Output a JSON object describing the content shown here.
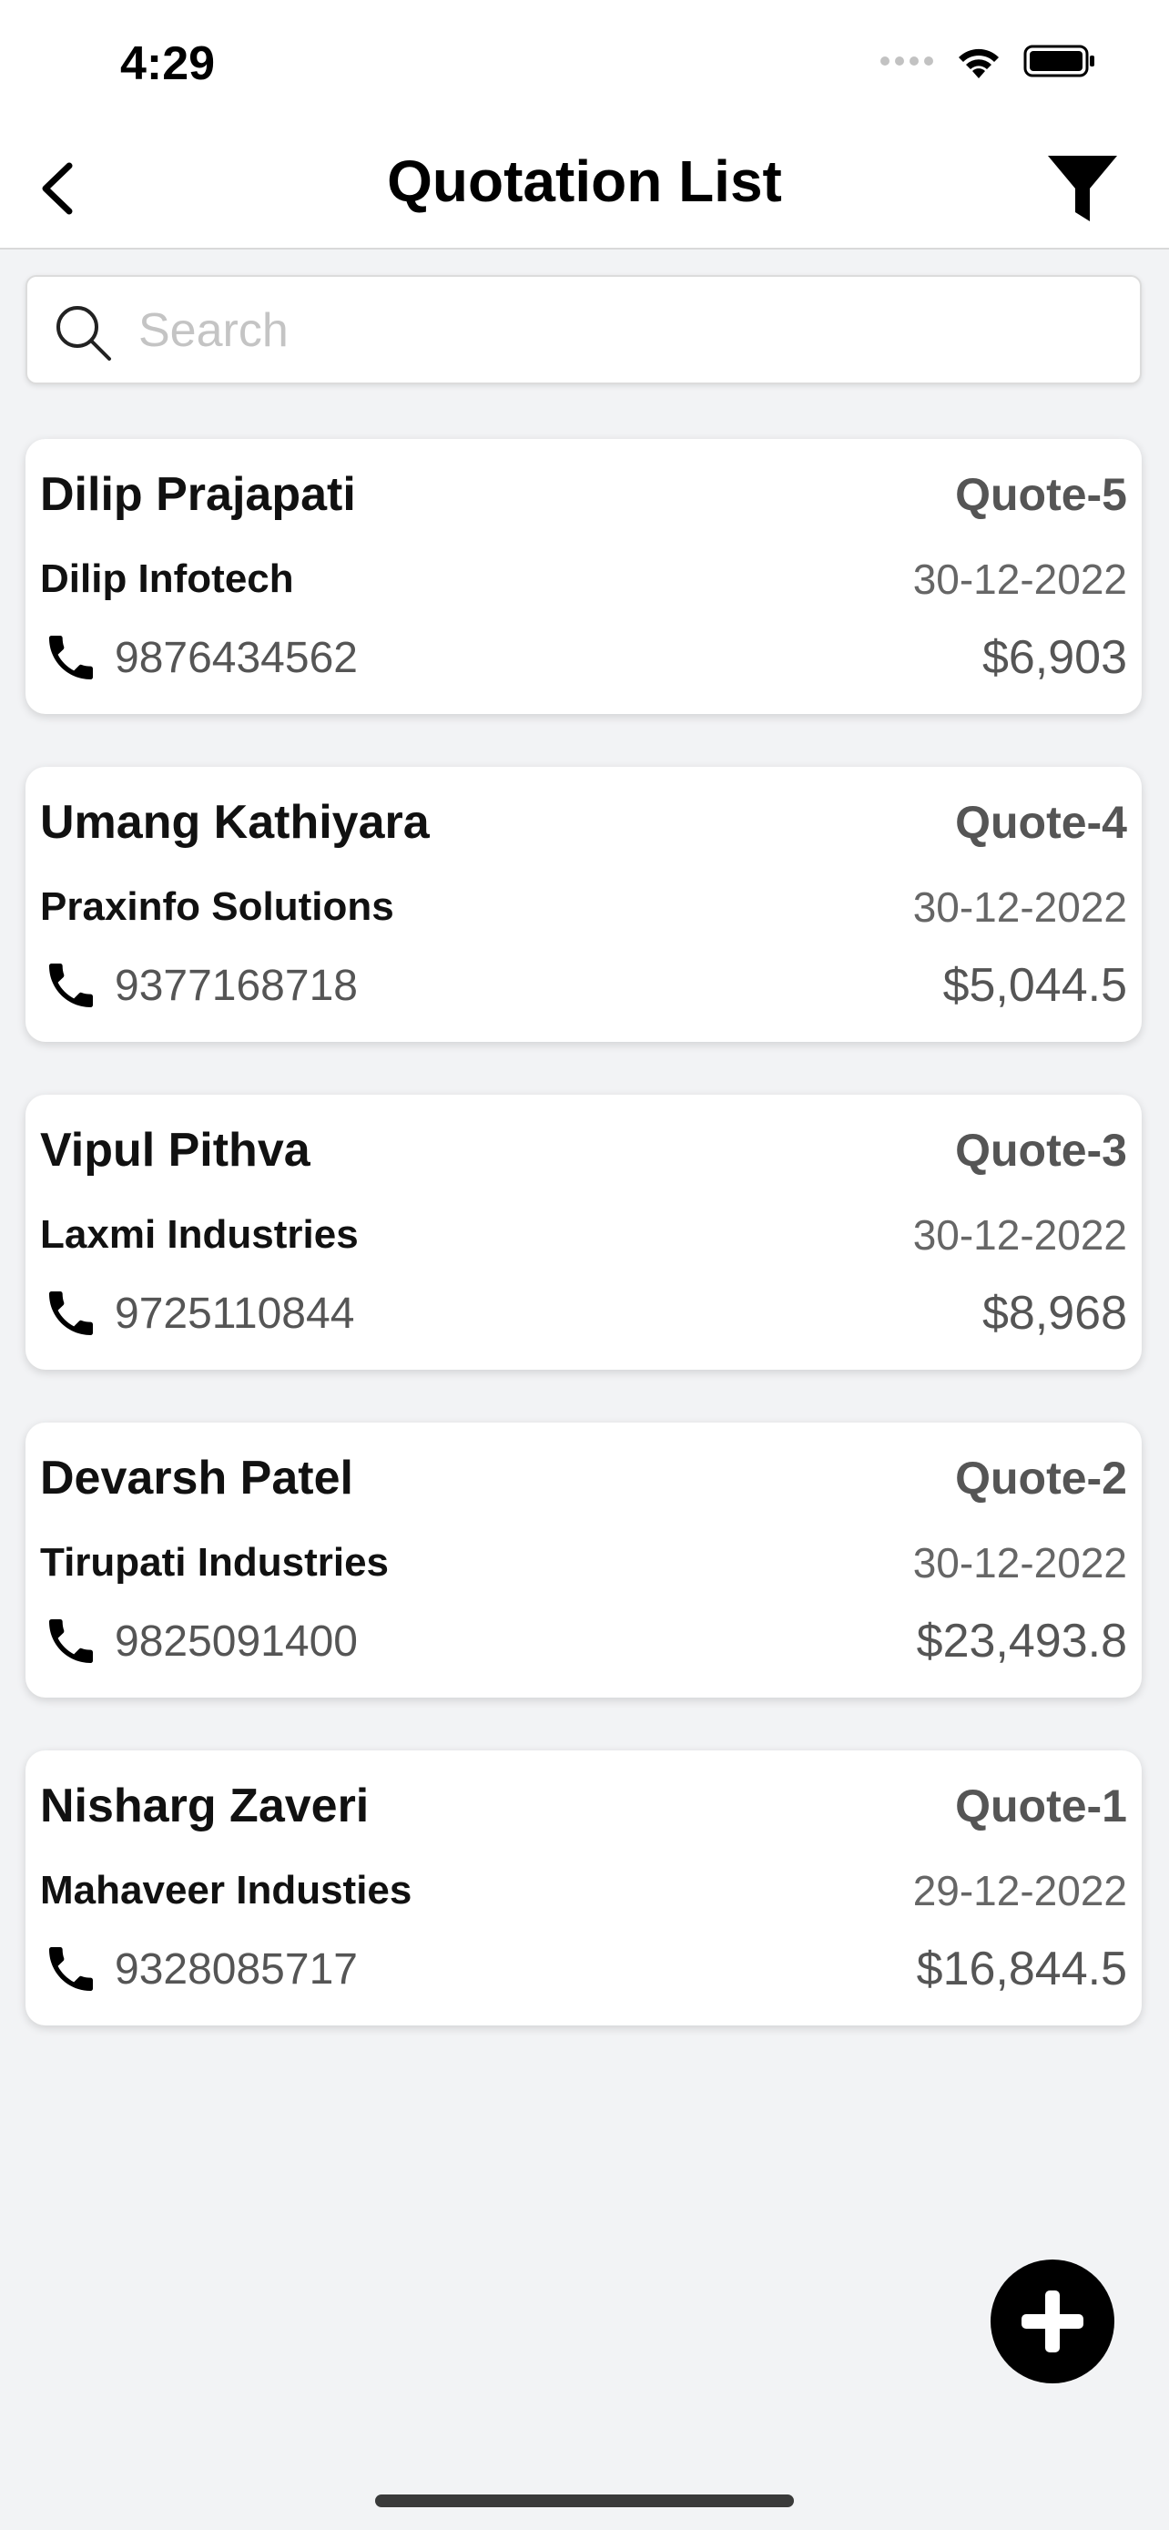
{
  "status_bar": {
    "time": "4:29",
    "icons": [
      "signal-dots-icon",
      "wifi-icon",
      "battery-icon"
    ]
  },
  "nav": {
    "title": "Quotation List",
    "back_icon": "chevron-left-icon",
    "filter_icon": "filter-icon"
  },
  "search": {
    "placeholder": "Search",
    "value": ""
  },
  "quotations": [
    {
      "name": "Dilip Prajapati",
      "quote": "Quote-5",
      "company": "Dilip Infotech",
      "date": "30-12-2022",
      "phone": "9876434562",
      "amount": "$6,903"
    },
    {
      "name": "Umang Kathiyara",
      "quote": "Quote-4",
      "company": "Praxinfo Solutions",
      "date": "30-12-2022",
      "phone": "9377168718",
      "amount": "$5,044.5"
    },
    {
      "name": "Vipul Pithva",
      "quote": "Quote-3",
      "company": "Laxmi Industries",
      "date": "30-12-2022",
      "phone": "9725110844",
      "amount": "$8,968"
    },
    {
      "name": "Devarsh Patel",
      "quote": "Quote-2",
      "company": "Tirupati Industries",
      "date": "30-12-2022",
      "phone": "9825091400",
      "amount": "$23,493.8"
    },
    {
      "name": "Nisharg Zaveri",
      "quote": "Quote-1",
      "company": "Mahaveer Industies",
      "date": "29-12-2022",
      "phone": "9328085717",
      "amount": "$16,844.5"
    }
  ],
  "fab": {
    "icon": "plus-icon"
  },
  "colors": {
    "background": "#f2f3f5",
    "card": "#ffffff",
    "primary_text": "#111111",
    "secondary_text": "#555555",
    "fab": "#000000"
  }
}
